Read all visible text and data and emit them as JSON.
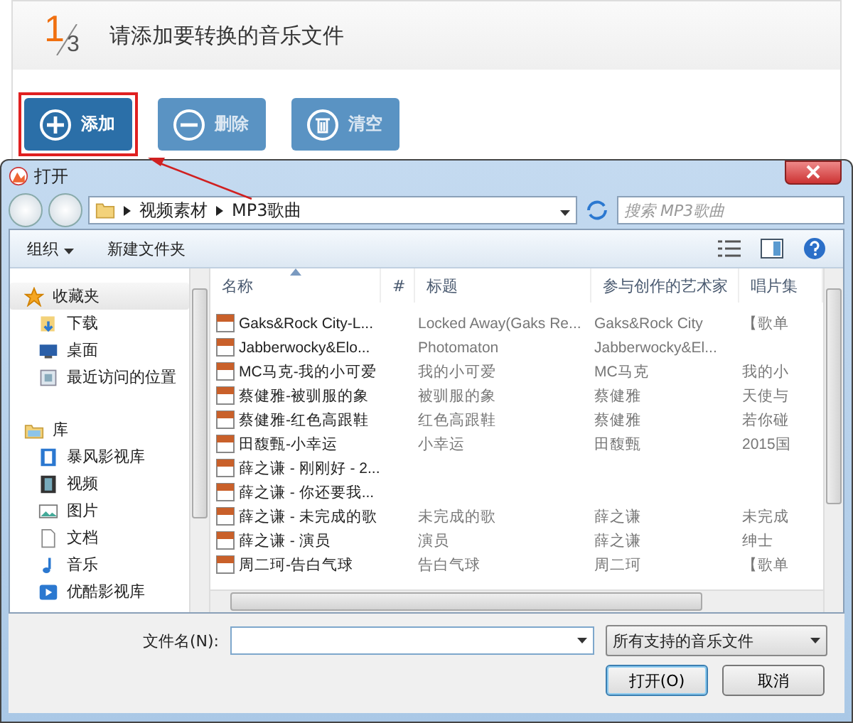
{
  "header": {
    "step": "1",
    "total": "3",
    "title": "请添加要转换的音乐文件"
  },
  "buttons": [
    {
      "kind": "add",
      "label": "添加",
      "disabled": false,
      "highlighted": true
    },
    {
      "kind": "remove",
      "label": "删除",
      "disabled": true,
      "highlighted": false
    },
    {
      "kind": "clear",
      "label": "清空",
      "disabled": true,
      "highlighted": false
    }
  ],
  "dialog": {
    "title": "打开",
    "breadcrumb": [
      "视频素材",
      "MP3歌曲"
    ],
    "search": {
      "placeholder": "搜索 MP3歌曲"
    },
    "commands": [
      {
        "label": "组织",
        "dropdown": true
      },
      {
        "label": "新建文件夹",
        "dropdown": false
      }
    ],
    "sidebar": [
      {
        "label": "收藏夹",
        "kind": "favorites",
        "selected": true,
        "children": [
          {
            "label": "下载",
            "kind": "downloads"
          },
          {
            "label": "桌面",
            "kind": "desktop"
          },
          {
            "label": "最近访问的位置",
            "kind": "recent"
          }
        ]
      },
      {
        "label": "库",
        "kind": "library",
        "selected": false,
        "children": [
          {
            "label": "暴风影视库",
            "kind": "media-library"
          },
          {
            "label": "视频",
            "kind": "video"
          },
          {
            "label": "图片",
            "kind": "pictures"
          },
          {
            "label": "文档",
            "kind": "documents"
          },
          {
            "label": "音乐",
            "kind": "music"
          },
          {
            "label": "优酷影视库",
            "kind": "play-library"
          }
        ]
      }
    ],
    "columns": [
      {
        "label": "名称",
        "sorted": true
      },
      {
        "label": "#",
        "sorted": false
      },
      {
        "label": "标题",
        "sorted": false
      },
      {
        "label": "参与创作的艺术家",
        "sorted": false
      },
      {
        "label": "唱片集",
        "sorted": false
      }
    ],
    "rows": [
      {
        "name": "Gaks&Rock City-L...",
        "title": "Locked Away(Gaks Re...",
        "artist": "Gaks&Rock City",
        "album": "【歌单"
      },
      {
        "name": "Jabberwocky&Elo...",
        "title": "Photomaton",
        "artist": "Jabberwocky&El..."
      },
      {
        "name": "MC马克-我的小可爱",
        "title": "我的小可爱",
        "artist": "MC马克",
        "album": "我的小"
      },
      {
        "name": "蔡健雅-被驯服的象",
        "title": "被驯服的象",
        "artist": "蔡健雅",
        "album": "天使与"
      },
      {
        "name": "蔡健雅-红色高跟鞋",
        "title": "红色高跟鞋",
        "artist": "蔡健雅",
        "album": "若你碰"
      },
      {
        "name": "田馥甄-小幸运",
        "title": "小幸运",
        "artist": "田馥甄",
        "album": "2015国"
      },
      {
        "name": "薛之谦 - 刚刚好 - 2..."
      },
      {
        "name": "薛之谦 - 你还要我..."
      },
      {
        "name": "薛之谦 - 未完成的歌",
        "title": "未完成的歌",
        "artist": "薛之谦",
        "album": "未完成"
      },
      {
        "name": "薛之谦 - 演员",
        "title": "演员",
        "artist": "薛之谦",
        "album": "绅士"
      },
      {
        "name": "周二珂-告白气球",
        "title": "告白气球",
        "artist": "周二珂",
        "album": "【歌单"
      }
    ],
    "filename_label": "文件名(N):",
    "filter": "所有支持的音乐文件",
    "actions": [
      {
        "label": "打开(O)",
        "default": true
      },
      {
        "label": "取消",
        "default": false
      }
    ]
  }
}
